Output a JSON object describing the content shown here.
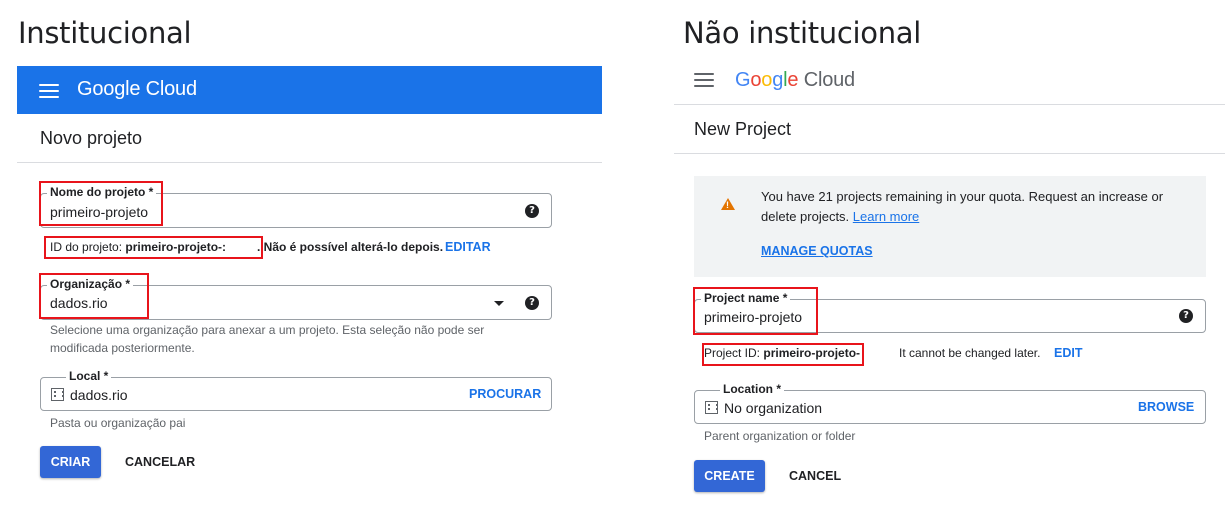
{
  "left": {
    "heading": "Institucional",
    "brand": "Google Cloud",
    "page_title": "Novo projeto",
    "project_name": {
      "label": "Nome do projeto *",
      "value": "primeiro-projeto"
    },
    "project_id": {
      "prefix": "ID do projeto: ",
      "value": "primeiro-projeto-:",
      "note": ". Não é possível alterá-lo depois.",
      "action": "EDITAR"
    },
    "organization": {
      "label": "Organização *",
      "value": "dados.rio",
      "hint": "Selecione uma organização para anexar a um projeto. Esta seleção não pode ser modificada posteriormente."
    },
    "location": {
      "label": "Local *",
      "value": "dados.rio",
      "action": "PROCURAR",
      "hint": "Pasta ou organização pai"
    },
    "create_label": "CRIAR",
    "cancel_label": "CANCELAR"
  },
  "right": {
    "heading": "Não institucional",
    "brand_letters": [
      "G",
      "o",
      "o",
      "g",
      "l",
      "e"
    ],
    "brand_suffix": "Cloud",
    "page_title": "New Project",
    "quota": {
      "text": "You have 21 projects remaining in your quota. Request an increase or delete projects.",
      "learn_more": "Learn more",
      "manage": "MANAGE QUOTAS"
    },
    "project_name": {
      "label": "Project name *",
      "value": "primeiro-projeto"
    },
    "project_id": {
      "prefix": "Project ID: ",
      "value": "primeiro-projeto-",
      "note": "It cannot be changed later.",
      "action": "EDIT"
    },
    "location": {
      "label": "Location *",
      "value": "No organization",
      "action": "BROWSE",
      "hint": "Parent organization or folder"
    },
    "create_label": "CREATE",
    "cancel_label": "CANCEL"
  },
  "colors": {
    "google_blue": "#4285f4",
    "google_red": "#ea4335",
    "google_yellow": "#fbbc05",
    "google_green": "#34a853",
    "header_blue": "#1a73e8",
    "primary_button": "#3367d6",
    "highlight_red": "#e8141b",
    "warning_orange": "#e37400"
  },
  "icons": [
    "menu-icon",
    "help-icon",
    "dropdown-caret-icon",
    "building-icon",
    "warning-icon"
  ]
}
